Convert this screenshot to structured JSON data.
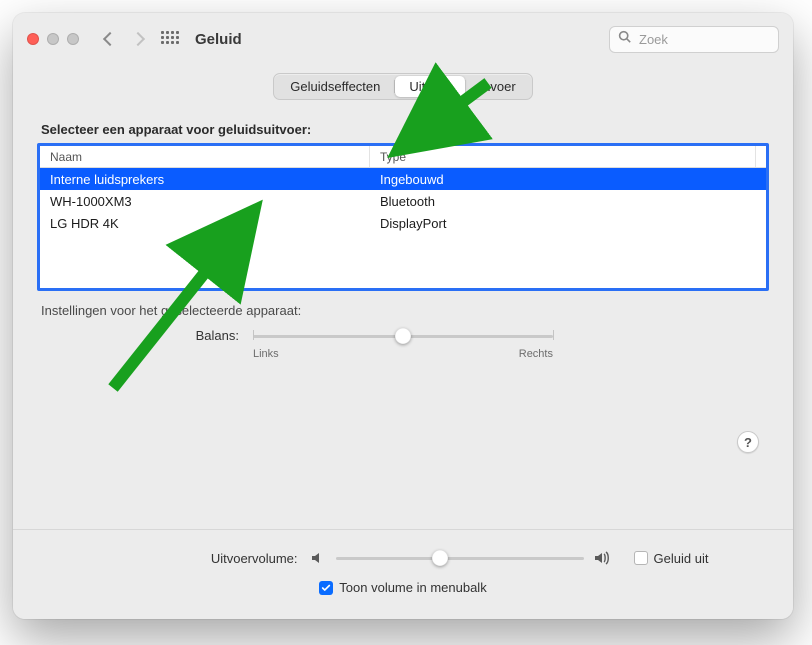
{
  "window": {
    "title": "Geluid"
  },
  "search": {
    "placeholder": "Zoek"
  },
  "tabs": {
    "sound_effects": "Geluidseffecten",
    "output": "Uitvoer",
    "input": "Invoer",
    "active": "output"
  },
  "output_section": {
    "prompt": "Selecteer een apparaat voor geluidsuitvoer:",
    "columns": {
      "name": "Naam",
      "type": "Type"
    },
    "devices": [
      {
        "name": "Interne luidsprekers",
        "type": "Ingebouwd",
        "selected": true
      },
      {
        "name": "WH-1000XM3",
        "type": "Bluetooth",
        "selected": false
      },
      {
        "name": "LG HDR 4K",
        "type": "DisplayPort",
        "selected": false
      }
    ],
    "settings_label": "Instellingen voor het geselecteerde apparaat:",
    "balance": {
      "label": "Balans:",
      "left": "Links",
      "right": "Rechts",
      "value_pct": 50
    }
  },
  "volume": {
    "label": "Uitvoervolume:",
    "value_pct": 42,
    "mute_label": "Geluid uit",
    "mute_checked": false,
    "show_in_menubar_label": "Toon volume in menubalk",
    "show_in_menubar_checked": true
  },
  "help_button": "?"
}
